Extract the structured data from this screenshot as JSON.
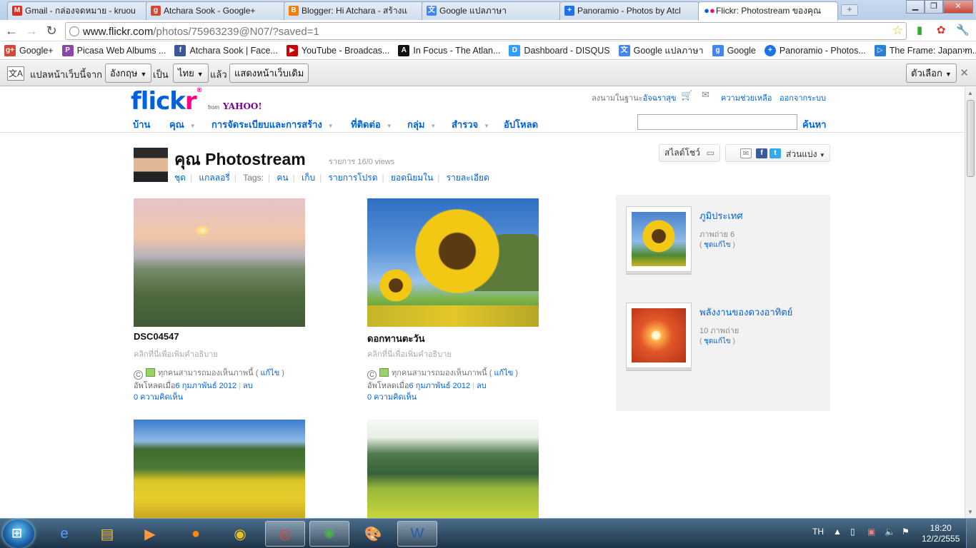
{
  "browser": {
    "tabs": [
      {
        "label": "Gmail - กล่องจดหมาย - kruou",
        "icon": "gmail-icon",
        "color": "#d93025"
      },
      {
        "label": "Atchara Sook - Google+",
        "icon": "google-plus-icon",
        "color": "#d34836"
      },
      {
        "label": "Blogger: Hi Atchara - สร้างแ",
        "icon": "blogger-icon",
        "color": "#f57d00"
      },
      {
        "label": "Google แปลภาษา",
        "icon": "google-translate-icon",
        "color": "#4285f4"
      },
      {
        "label": "Panoramio - Photos by Atcl",
        "icon": "panoramio-icon",
        "color": "#1a73e8"
      },
      {
        "label": "Flickr: Photostream ของคุณ",
        "icon": "flickr-icon",
        "color": "#ff0084"
      }
    ],
    "url_host": "www.flickr.com",
    "url_path": "/photos/75963239@N07/?saved=1",
    "bookmarks": [
      {
        "label": "Google+",
        "icon": "google-plus-icon",
        "color": "#d34836",
        "glyph": "g+"
      },
      {
        "label": "Picasa Web Albums ...",
        "icon": "picasa-icon",
        "color": "#8e44ad",
        "glyph": "P"
      },
      {
        "label": "Atchara Sook | Face...",
        "icon": "facebook-icon",
        "color": "#3b5998",
        "glyph": "f"
      },
      {
        "label": "YouTube - Broadcas...",
        "icon": "youtube-icon",
        "color": "#cc0000",
        "glyph": "▶"
      },
      {
        "label": "In Focus - The Atlan...",
        "icon": "atlantic-icon",
        "color": "#111111",
        "glyph": "A"
      },
      {
        "label": "Dashboard - DISQUS",
        "icon": "disqus-icon",
        "color": "#2e9fff",
        "glyph": "D"
      },
      {
        "label": "Google แปลภาษา",
        "icon": "google-translate-icon",
        "color": "#4285f4",
        "glyph": "文"
      },
      {
        "label": "Google",
        "icon": "google-icon",
        "color": "#4285f4",
        "glyph": "g"
      },
      {
        "label": "Panoramio - Photos...",
        "icon": "panoramio-icon",
        "color": "#1a73e8",
        "glyph": "+"
      },
      {
        "label": "The Frame: Japan m...",
        "icon": "the-frame-icon",
        "color": "#2a7fd6",
        "glyph": "▷"
      }
    ],
    "bookmarks_more": "»",
    "translate_bar": {
      "prefix": "แปลหน้าเว็บนี้จาก",
      "from_lang": "อังกฤษ",
      "to_word": "เป็น",
      "to_lang": "ไทย",
      "then_word": "แล้ว",
      "show_original": "แสดงหน้าเว็บเดิม",
      "options": "ตัวเลือก"
    }
  },
  "flickr": {
    "logo_a": "flick",
    "logo_b": "r",
    "from": "from",
    "yahoo": "YAHOO!",
    "signed_in_prefix": "ลงนามในฐานะ",
    "signed_in_user": "อัจฉราสุข",
    "help": "ความช่วยเหลือ",
    "signout": "ออกจากระบบ",
    "nav": [
      "บ้าน",
      "คุณ",
      "การจัดระเบียบและการสร้าง",
      "ที่ติดต่อ",
      "กลุ่ม",
      "สำรวจ",
      "อัปโหลด"
    ],
    "search_label": "ค้นหา",
    "photostream_title": "คุณ Photostream",
    "views": "รายการ 16/0 views",
    "subnav": [
      "ชุด",
      "แกลลอรี่",
      "Tags:",
      "คน",
      "เก็บ",
      "รายการโปรด",
      "ยอดนิยมใน",
      "รายละเอียด"
    ],
    "slideshow": "สไลด์โชว์",
    "share": "ส่วนแบ่ง",
    "photos": [
      {
        "title": "DSC04547",
        "desc": "คลิกที่นี่เพื่อเพิ่มคำอธิบาย",
        "license": "ทุกคนสามารถมองเห็นภาพนี้",
        "edit": "แก้ไข",
        "uploaded_prefix": "อัพโหลดเมื่อ",
        "uploaded_date": "6 กุมภาพันธ์ 2012",
        "delete": "ลบ",
        "comments": "0 ความคิดเห็น"
      },
      {
        "title": "ดอกทานตะวัน",
        "desc": "คลิกที่นี่เพื่อเพิ่มคำอธิบาย",
        "license": "ทุกคนสามารถมองเห็นภาพนี้",
        "edit": "แก้ไข",
        "uploaded_prefix": "อัพโหลดเมื่อ",
        "uploaded_date": "6 กุมภาพันธ์ 2012",
        "delete": "ลบ",
        "comments": "0 ความคิดเห็น"
      }
    ],
    "sets": [
      {
        "title": "ภูมิประเทศ",
        "count": "ภาพถ่าย 6",
        "edit": "ชุดแก้ไข"
      },
      {
        "title": "พลังงานของดวงอาทิตย์",
        "count": "10 ภาพถ่าย",
        "edit": "ชุดแก้ไข"
      }
    ]
  },
  "taskbar": {
    "lang": "TH",
    "time": "18:20",
    "date": "12/2/2555"
  }
}
